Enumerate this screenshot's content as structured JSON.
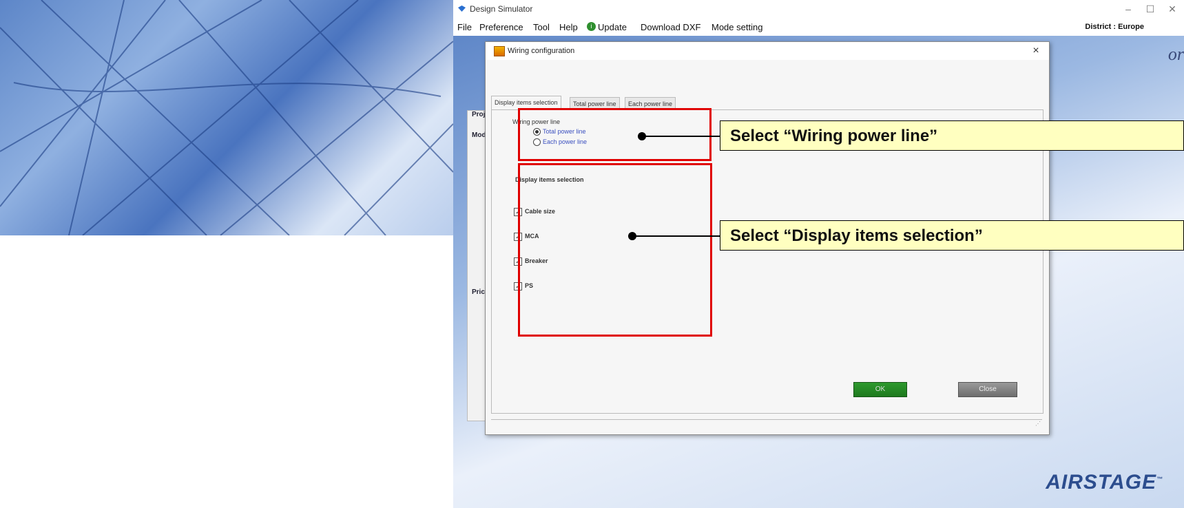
{
  "window": {
    "title": "Design Simulator",
    "minimize": "–",
    "maximize": "☐",
    "close": "✕"
  },
  "menu": {
    "items": [
      "File",
      "Preference",
      "Tool",
      "Help",
      "Update",
      "Download DXF",
      "Mode setting"
    ],
    "update_icon": "info-circle-icon",
    "district": "District : Europe"
  },
  "background": {
    "banner_fragment": "or",
    "side_labels": [
      "Proj",
      "Mod",
      "Pric"
    ],
    "brand": "AIRSTAGE",
    "brand_tm": "™"
  },
  "dialog": {
    "title": "Wiring configuration",
    "close": "×",
    "tabs": [
      "Display items selection",
      "Total power line",
      "Each power line"
    ],
    "active_tab": 0,
    "wiring_group": {
      "label": "Wiring power line",
      "options": [
        {
          "label": "Total power line",
          "selected": true
        },
        {
          "label": "Each power line",
          "selected": false
        }
      ]
    },
    "display_group": {
      "label": "Display items selection",
      "items": [
        {
          "label": "Cable size",
          "checked": true
        },
        {
          "label": "MCA",
          "checked": true
        },
        {
          "label": "Breaker",
          "checked": true
        },
        {
          "label": "PS",
          "checked": true
        }
      ]
    },
    "ok": "OK",
    "close_button": "Close"
  },
  "annotations": {
    "callout1": "Select “Wiring power line”",
    "callout2": "Select “Display items selection”",
    "highlight_color": "#e00000",
    "callout_color": "#ffffc0"
  }
}
